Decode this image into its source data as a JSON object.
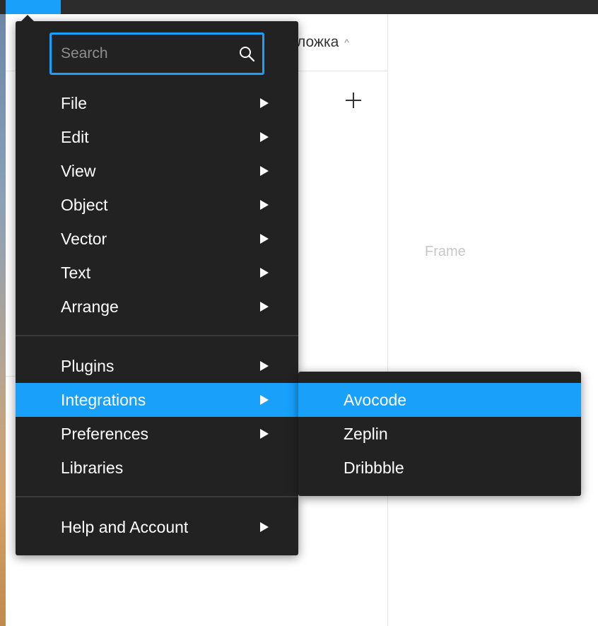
{
  "topbar": {
    "active_color": "#18a0fb"
  },
  "background": {
    "page_tab_label": "ложка",
    "page_tab_chevron": "^",
    "add_icon": "plus-icon",
    "frame_label": "Frame"
  },
  "menu": {
    "search": {
      "placeholder": "Search",
      "value": "",
      "icon": "search-icon"
    },
    "items": [
      {
        "label": "File",
        "has_submenu": true
      },
      {
        "label": "Edit",
        "has_submenu": true
      },
      {
        "label": "View",
        "has_submenu": true
      },
      {
        "label": "Object",
        "has_submenu": true
      },
      {
        "label": "Vector",
        "has_submenu": true
      },
      {
        "label": "Text",
        "has_submenu": true
      },
      {
        "label": "Arrange",
        "has_submenu": true
      },
      {
        "label": "Plugins",
        "has_submenu": true
      },
      {
        "label": "Integrations",
        "has_submenu": true,
        "active": true
      },
      {
        "label": "Preferences",
        "has_submenu": true
      },
      {
        "label": "Libraries",
        "has_submenu": false
      },
      {
        "label": "Help and Account",
        "has_submenu": true
      }
    ]
  },
  "submenu": {
    "items": [
      {
        "label": "Avocode",
        "active": true
      },
      {
        "label": "Zeplin"
      },
      {
        "label": "Dribbble"
      }
    ]
  },
  "colors": {
    "menu_bg": "#222222",
    "highlight": "#18a0fb",
    "text": "#ffffff"
  }
}
